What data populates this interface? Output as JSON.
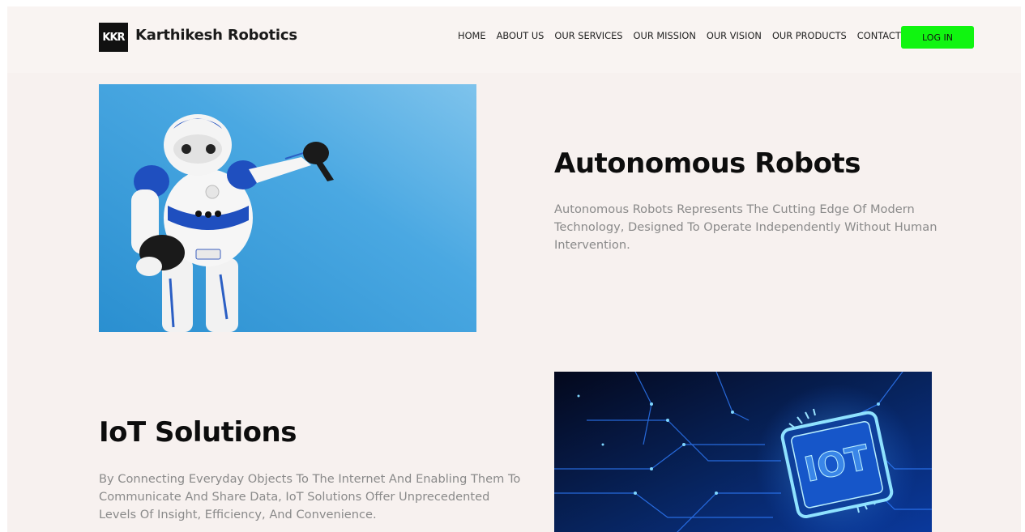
{
  "header": {
    "logo_text": "KKR",
    "brand": "Karthikesh Robotics",
    "nav": [
      "HOME",
      "ABOUT US",
      "OUR SERVICES",
      "OUR MISSION",
      "OUR VISION",
      "OUR PRODUCTS",
      "CONTACT"
    ],
    "login_label": "LOG IN",
    "login_color": "#10f510"
  },
  "sections": [
    {
      "title": "Autonomous Robots",
      "text": "Autonomous Robots Represents The Cutting Edge Of Modern Technology, Designed To Operate Independently Without Human Intervention."
    },
    {
      "title": "IoT Solutions",
      "text": "By Connecting Everyday Objects To The Internet And Enabling Them To Communicate And Share Data, IoT Solutions Offer Unprecedented Levels Of Insight, Efficiency, And Convenience."
    }
  ],
  "images": {
    "robot": "robot-photo",
    "iot": "iot-chip-photo",
    "iot_chip_label": "IOT"
  }
}
